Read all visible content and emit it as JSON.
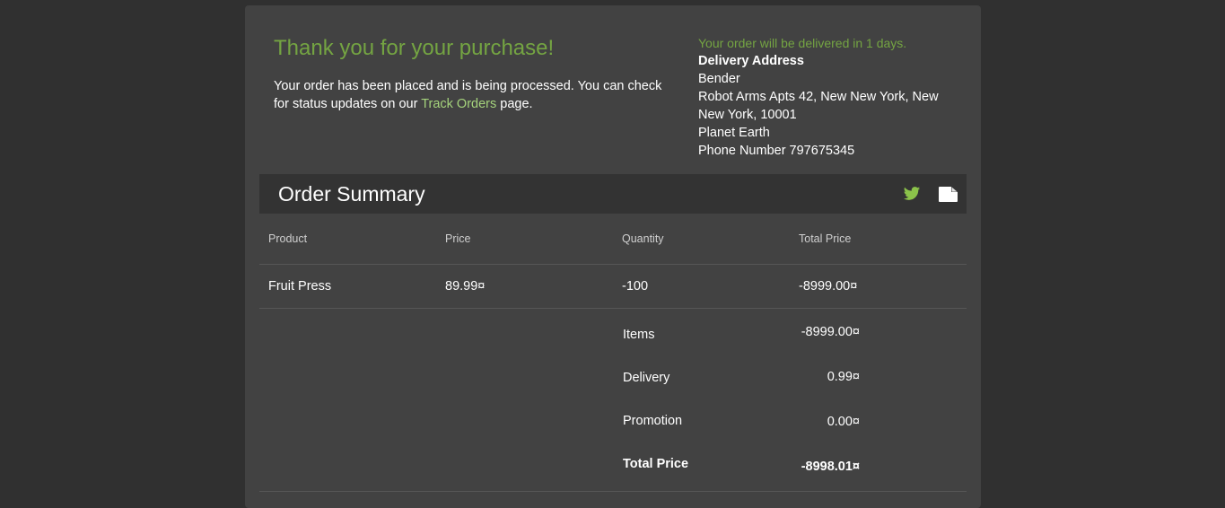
{
  "confirmation": {
    "title": "Thank you for your purchase!",
    "message_before": "Your order has been placed and is being processed. You can check for status updates on our ",
    "track_link": "Track Orders",
    "message_after": " page."
  },
  "delivery": {
    "eta": "Your order will be delivered in 1 days.",
    "address_label": "Delivery Address",
    "name": "Bender",
    "street": "Robot Arms Apts 42, New New York, New New York, 10001",
    "planet": "Planet Earth",
    "phone": "Phone Number 797675345"
  },
  "summary": {
    "title": "Order Summary",
    "icons": [
      "twitter-icon",
      "document-icon"
    ],
    "columns": [
      "Product",
      "Price",
      "Quantity",
      "Total Price"
    ],
    "rows": [
      {
        "product": "Fruit Press",
        "price": "89.99¤",
        "quantity": "-100",
        "total": "-8999.00¤"
      }
    ],
    "totals": {
      "items_label": "Items",
      "items_value": "-8999.00¤",
      "delivery_label": "Delivery",
      "delivery_value": "0.99¤",
      "promotion_label": "Promotion",
      "promotion_value": "0.00¤",
      "total_label": "Total Price",
      "total_value": "-8998.01¤"
    }
  },
  "colors": {
    "background": "#303030",
    "card": "#424242",
    "header_bar": "#333333",
    "accent_green": "#74a442",
    "link_green": "#a5d37c",
    "twitter_icon": "#8bc34a"
  }
}
